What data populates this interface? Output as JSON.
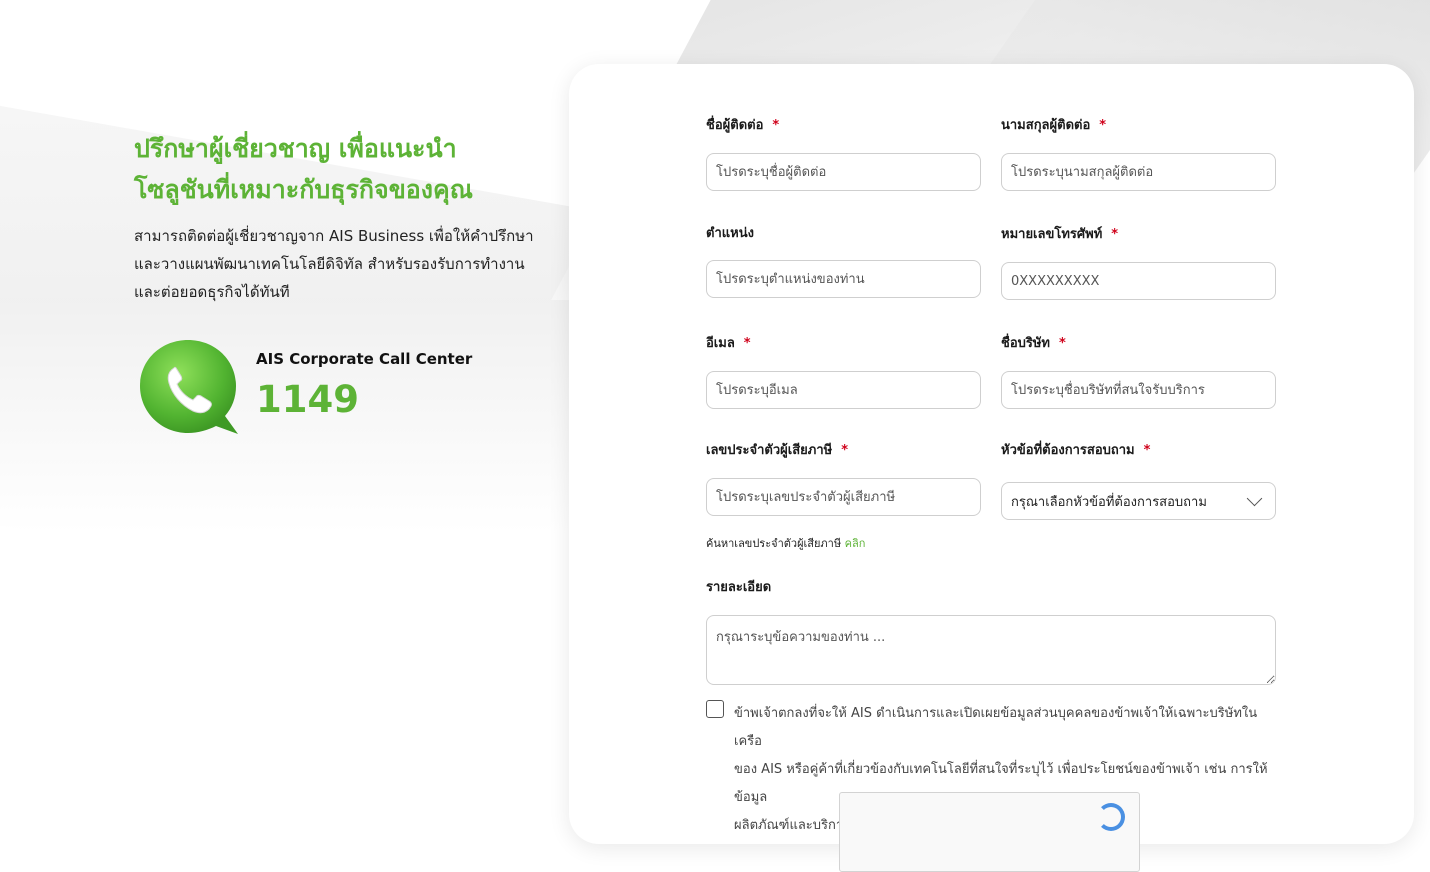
{
  "hero": {
    "headline_line1": "ปรึกษาผู้เชี่ยวชาญ เพื่อแนะนำ",
    "headline_line2": "โซลูชันที่เหมาะกับธุรกิจของคุณ",
    "desc_line1": "สามารถติดต่อผู้เชี่ยวชาญจาก AIS Business เพื่อให้คำปรึกษา",
    "desc_line2": "และวางแผนพัฒนาเทคโนโลยีดิจิทัล  สำหรับรองรับการทำงาน",
    "desc_line3": "และต่อยอดธุรกิจได้ทันที",
    "accent_color": "#5db336"
  },
  "call_center": {
    "label": "AIS Corporate Call Center",
    "number": "1149",
    "icon": "phone-chat-bubble-icon"
  },
  "form": {
    "required_mark": "*",
    "first_name": {
      "label": "ชื่อผู้ติดต่อ",
      "placeholder": "โปรดระบุชื่อผู้ติดต่อ",
      "value": ""
    },
    "last_name": {
      "label": "นามสกุลผู้ติดต่อ",
      "placeholder": "โปรดระบุนามสกุลผู้ติดต่อ",
      "value": ""
    },
    "position": {
      "label": "ตำแหน่ง",
      "placeholder": "โปรดระบุตำแหน่งของท่าน",
      "value": ""
    },
    "phone": {
      "label": "หมายเลขโทรศัพท์",
      "placeholder": "0XXXXXXXXX",
      "value": ""
    },
    "email": {
      "label": "อีเมล",
      "placeholder": "โปรดระบุอีเมล",
      "value": ""
    },
    "company": {
      "label": "ชื่อบริษัท",
      "placeholder": "โปรดระบุชื่อบริษัทที่สนใจรับบริการ",
      "value": ""
    },
    "tax_id": {
      "label": "เลขประจำตัวผู้เสียภาษี",
      "placeholder": "โปรดระบุเลขประจำตัวผู้เสียภาษี",
      "value": ""
    },
    "tax_hint": {
      "text": "ค้นหาเลขประจำตัวผู้เสียภาษี",
      "link": "คลิก"
    },
    "topic": {
      "label": "หัวข้อที่ต้องการสอบถาม",
      "selected": "กรุณาเลือกหัวข้อที่ต้องการสอบถาม"
    },
    "details": {
      "label": "รายละเอียด",
      "placeholder": "กรุณาระบุข้อความของท่าน ..."
    },
    "consent": {
      "checked": false,
      "line1": "ข้าพเจ้าตกลงที่จะให้ AIS ดำเนินการและเปิดเผยข้อมูลส่วนบุคคลของข้าพเจ้าให้เฉพาะบริษัทในเครือ",
      "line2": "ของ AIS หรือคู่ค้าที่เกี่ยวข้องกับเทคโนโลยีที่สนใจที่ระบุไว้ เพื่อประโยชน์ของข้าพเจ้า เช่น การให้ข้อมูล",
      "line3": "ผลิตภัณฑ์และบริการ เป็นต้น"
    }
  }
}
